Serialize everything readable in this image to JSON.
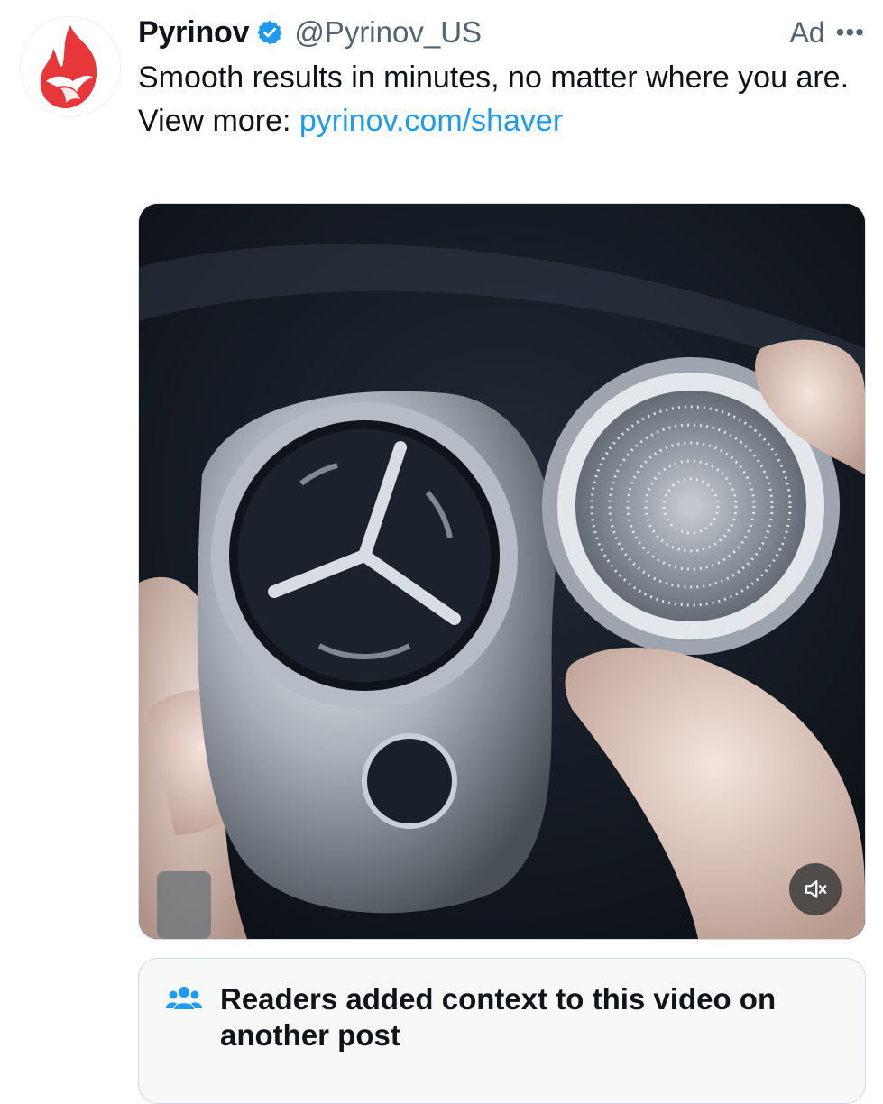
{
  "post": {
    "display_name": "Pyrinov",
    "handle": "@Pyrinov_US",
    "ad_label": "Ad",
    "more_label": "•••",
    "text_line": "Smooth results in minutes, no matter where you are.",
    "view_more_prefix": "View more: ",
    "link_text": "pyrinov.com/shaver",
    "verified": true
  },
  "media": {
    "type": "video",
    "muted": true,
    "mute_icon": "speaker-muted-icon"
  },
  "context_card": {
    "icon": "people-icon",
    "text": "Readers added context to this video on another post"
  },
  "colors": {
    "link": "#1d9bf0",
    "verified_badge": "#1d9bf0",
    "secondary_text": "#536471",
    "logo_red": "#e8373b",
    "context_icon": "#1d9bf0"
  }
}
